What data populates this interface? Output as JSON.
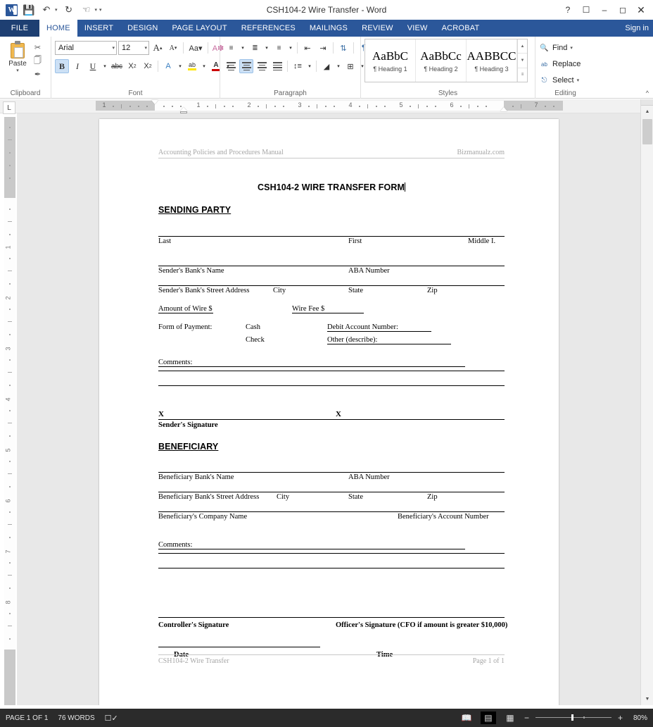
{
  "window": {
    "title": "CSH104-2 Wire Transfer - Word",
    "quick_access": [
      {
        "name": "save",
        "glyph": "▤"
      },
      {
        "name": "undo",
        "glyph": "↶"
      },
      {
        "name": "redo",
        "glyph": "↻"
      },
      {
        "name": "touch-mode",
        "glyph": "☚"
      },
      {
        "name": "customize",
        "glyph": "▾"
      }
    ],
    "help_label": "?",
    "ribbon_display_label": "⬆",
    "minimize_label": "–",
    "restore_label": "❐",
    "close_label": "✕",
    "sign_in_label": "Sign in"
  },
  "ribbon": {
    "file_tab": "FILE",
    "tabs": [
      {
        "label": "HOME",
        "active": true
      },
      {
        "label": "INSERT",
        "active": false
      },
      {
        "label": "DESIGN",
        "active": false
      },
      {
        "label": "PAGE LAYOUT",
        "active": false
      },
      {
        "label": "REFERENCES",
        "active": false
      },
      {
        "label": "MAILINGS",
        "active": false
      },
      {
        "label": "REVIEW",
        "active": false
      },
      {
        "label": "VIEW",
        "active": false
      },
      {
        "label": "ACROBAT",
        "active": false
      }
    ],
    "clipboard": {
      "label": "Clipboard",
      "paste_label": "Paste",
      "cut_glyph": "✂",
      "copy_glyph": "❐",
      "format_painter_glyph": "🖌",
      "dialog_launcher": "↘"
    },
    "font": {
      "label": "Font",
      "font_name": "Arial",
      "font_size": "12",
      "grow_label": "A",
      "shrink_label": "A",
      "change_case_label": "Aa",
      "clear_format_label": "A",
      "bold_label": "B",
      "italic_label": "I",
      "underline_label": "U",
      "strikethrough_label": "abc",
      "subscript_label": "X",
      "superscript_label": "X",
      "text_effects_label": "A",
      "highlight_label": "ab",
      "font_color_label": "A",
      "dialog_launcher": "↘"
    },
    "paragraph": {
      "label": "Paragraph",
      "bullets_glyph": "☰",
      "numbering_glyph": "☰",
      "multilevel_glyph": "☰",
      "decrease_indent_glyph": "←",
      "increase_indent_glyph": "→",
      "sort_glyph": "↕",
      "show_marks_glyph": "¶",
      "align_left_glyph": "☰",
      "align_center_glyph": "☰",
      "align_right_glyph": "☰",
      "justify_glyph": "☰",
      "line_spacing_glyph": "↕",
      "shading_glyph": "◢",
      "borders_glyph": "⊞",
      "dialog_launcher": "↘"
    },
    "styles": {
      "label": "Styles",
      "items": [
        {
          "preview": "AaBbC",
          "name": "¶ Heading 1"
        },
        {
          "preview": "AaBbCc",
          "name": "¶ Heading 2"
        },
        {
          "preview": "AABBCС",
          "name": "¶ Heading 3"
        }
      ],
      "scroll_up": "▴",
      "scroll_down": "▾",
      "more": "≡",
      "dialog_launcher": "↘"
    },
    "editing": {
      "label": "Editing",
      "find_label": "Find",
      "find_caret": "▾",
      "replace_label": "Replace",
      "select_label": "Select",
      "select_caret": "▾",
      "find_icon_glyph": "🔍",
      "replace_icon_glyph": "ab",
      "select_icon_glyph": "↖"
    },
    "collapse_glyph": "∧"
  },
  "ruler": {
    "tab_selector_label": "L",
    "horizontal_numbers": [
      "1",
      "1",
      "2",
      "3",
      "4",
      "5",
      "6",
      "7"
    ],
    "vertical_numbers": [
      "1",
      "2",
      "3",
      "4",
      "5",
      "6",
      "7",
      "8"
    ]
  },
  "document": {
    "header_left": "Accounting Policies and Procedures Manual",
    "header_right": "Bizmanualz.com",
    "title": "CSH104-2 WIRE TRANSFER FORM",
    "sending_party_heading": "SENDING PARTY",
    "name_fields": {
      "last": "Last",
      "first": "First",
      "middle": "Middle I."
    },
    "sender_bank": {
      "name": "Sender's Bank's Name",
      "aba": "ABA Number"
    },
    "sender_address": {
      "street": "Sender's Bank's Street Address",
      "city": "City",
      "state": "State",
      "zip": "Zip"
    },
    "amounts": {
      "wire_label": "Amount of Wire $",
      "fee_label": "Wire Fee $"
    },
    "payment": {
      "form_label": "Form of Payment:",
      "cash": "Cash",
      "check": "Check",
      "debit_label": "Debit Account Number:",
      "other_label": "Other (describe):"
    },
    "comments_label": "Comments:",
    "signature_mark": "X",
    "sender_signature_label": "Sender's Signature",
    "beneficiary_heading": "BENEFICIARY",
    "beneficiary_bank": {
      "name": "Beneficiary Bank's Name",
      "aba": "ABA Number"
    },
    "beneficiary_address": {
      "street": "Beneficiary Bank's Street Address",
      "city": "City",
      "state": "State",
      "zip": "Zip"
    },
    "beneficiary_company": {
      "name": "Beneficiary's Company Name",
      "account": "Beneficiary's Account Number"
    },
    "comments_label2": "Comments:",
    "controller_signature_label": "Controller's Signature",
    "officer_signature_label": "Officer's Signature (CFO if amount is greater $10,000)",
    "date_label": "Date",
    "time_label": "Time",
    "footer_left": "CSH104-2 Wire Transfer",
    "footer_right": "Page 1 of 1"
  },
  "status_bar": {
    "page_label": "PAGE 1 OF 1",
    "word_count": "76 WORDS",
    "proofing_glyph": "📖",
    "read_mode_glyph": "📖",
    "print_layout_glyph": "▤",
    "web_layout_glyph": "▦",
    "zoom_out_label": "−",
    "zoom_in_label": "+",
    "zoom_level": "80%"
  },
  "scrollbar": {
    "up_glyph": "▲",
    "down_glyph": "▼",
    "split_glyph": ""
  },
  "colors": {
    "ribbon_blue": "#2b579a",
    "file_tab_blue": "#1e3f72",
    "highlight_blue": "#cce0f5",
    "status_bar": "#2b2b2b",
    "workspace_gray": "#e8e8e8"
  }
}
